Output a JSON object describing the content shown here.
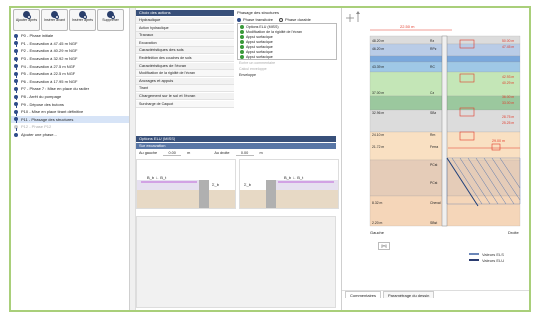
{
  "toolbar": {
    "buttons": [
      {
        "label": "Ajouter après",
        "icon": "add-phase-icon"
      },
      {
        "label": "Insérer avant",
        "icon": "insert-before-icon"
      },
      {
        "label": "Insérer après",
        "icon": "insert-after-icon"
      },
      {
        "label": "Supprimer",
        "icon": "delete-icon"
      }
    ]
  },
  "phases": [
    "P0 - Phase initiale",
    "P1 - Excavation à 47.45 m NGF",
    "P2 - Excavation à 40.29 m NGF",
    "P3 - Excavation à 32.92 m NGF",
    "P4 - Excavation à 27.5 m NGF",
    "P5 - Excavation à 22.5 m NGF",
    "P6 - Excavation à 17.95 m NGF",
    "P7 - Phase 7 : Mise en place du radier",
    "P8 - Arrêt du pompage",
    "P9 - Dépose des butons",
    "P10 - Mise en place tirant définitive",
    "P11 - Phasage des structures",
    "P12 - Phase P12",
    "Ajouter une phase..."
  ],
  "selected_phase_index": 11,
  "menu": {
    "header": "Choix des actions",
    "items": [
      "Hydraulique",
      "Action hydraulique",
      "Travaux",
      "Excavation",
      "Caractéristiques des sols",
      "Redéfinition des couches de sols",
      "Caractéristiques de l'écran",
      "Modification de la rigidité de l'écran",
      "Ancrages et appuis",
      "Tirant",
      "Chargement sur le sol et l'écran",
      "Surcharge de Caquot"
    ],
    "sub_items": [
      1,
      3,
      5,
      7,
      9,
      11
    ]
  },
  "options": {
    "title": "Phasage des structures",
    "radio_a": "Phase transitoire",
    "radio_b": "Phase durable",
    "checks": [
      "Options ELU (MISS)",
      "Modification de la rigidité de l'écran",
      "Appui surfacique",
      "Appui surfacique",
      "Appui surfacique",
      "Appui surfacique",
      "Appui surfacique"
    ],
    "disabled": [
      "Ecrire un commentaire",
      "Calcul enveloppe"
    ],
    "envelope": "Enveloppe"
  },
  "subpanel": {
    "header": "Options ELU (MISS)",
    "subheader": "Sur excavation",
    "left_label": "Au gauche",
    "left_value": "0.00",
    "left_unit": "m",
    "right_label": "Au droite",
    "right_value": "0.00",
    "right_unit": "m",
    "diagram_left": {
      "top": "Δ_y",
      "mid": "B_b ∟ B_t",
      "side": "Σ_b"
    },
    "diagram_right": {
      "top": "Δ_y",
      "mid": "B_b ∟ B_t",
      "side": "Σ_b"
    }
  },
  "right": {
    "top_dim": "22.50 m",
    "right_dim": "29.00 m",
    "depth_labels": [
      "48.20 m",
      "46.20 m",
      "43.39 m",
      "37.00 m",
      "32.96 m",
      "24.10 m",
      "21.72 m",
      "8.32 m",
      "2.20 m"
    ],
    "right_depth_labels": [
      "50.00 m",
      "47.45 m",
      "42.93 m",
      "40.29 m",
      "36.00 m",
      "33.00 m",
      "28.75 m",
      "25.25 m"
    ],
    "layer_labels": [
      "Rz",
      "RPz",
      "RC",
      "Cz",
      "SBz",
      "Rm",
      "Ferra",
      "PCst",
      "PCst",
      "Cheval",
      "SBst"
    ],
    "bottom_left": "Gauche",
    "bottom_right": "Droite",
    "mini_label": "[m]",
    "legend": [
      {
        "label": "Valeurs ELS",
        "color": "#6b86b8"
      },
      {
        "label": "Valeurs ELU",
        "color": "#2b3c70"
      }
    ],
    "tabs": [
      "Commentaires",
      "Paramétrage du dessin"
    ],
    "active_tab": 0,
    "colors": {
      "layer1": "#dcdcdc",
      "layer2": "#b9cce7",
      "layer3": "#9fc8e6",
      "layer4": "#c4e6b7",
      "layer5": "#9bc89e",
      "layer6": "#f9e0c2",
      "layer7": "#e5ccb8",
      "layer8": "#f5d6b9",
      "water": "#7aa8dc",
      "red": "#e23a2a",
      "hatch": "#3460a8"
    }
  }
}
